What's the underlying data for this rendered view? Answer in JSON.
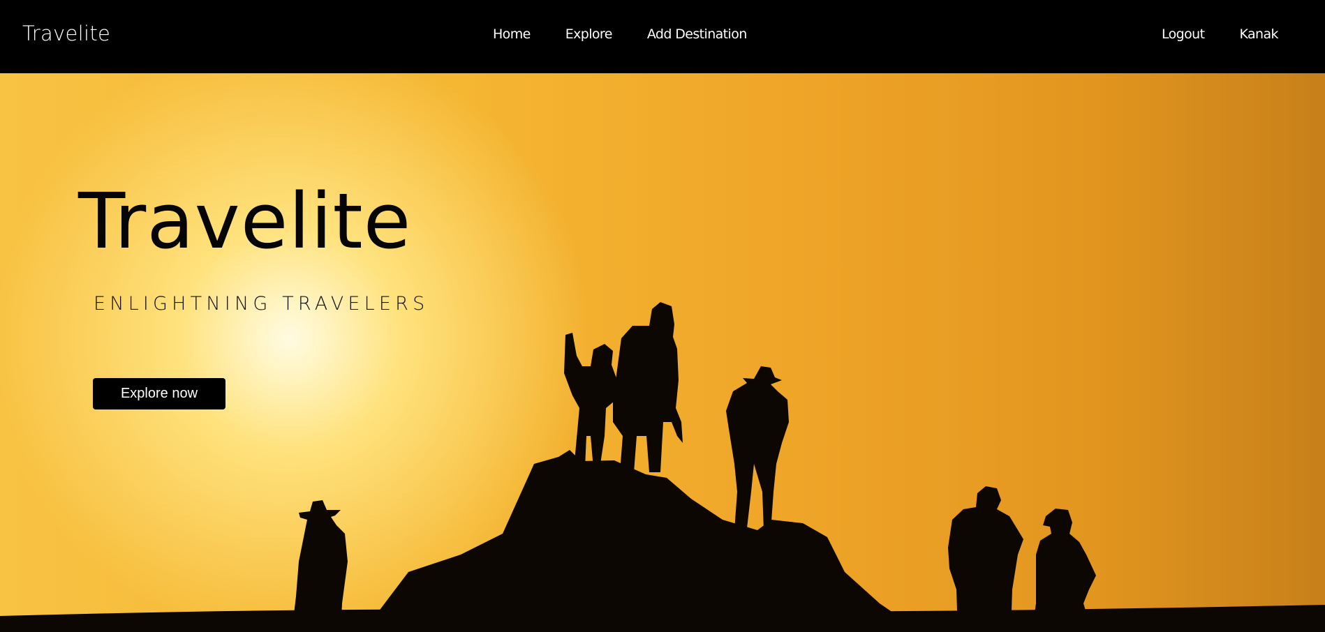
{
  "navbar": {
    "brand": "Travelite",
    "links": [
      {
        "label": "Home"
      },
      {
        "label": "Explore"
      },
      {
        "label": "Add Destination"
      }
    ],
    "user_links": [
      {
        "label": "Logout"
      },
      {
        "label": "Kanak"
      }
    ]
  },
  "hero": {
    "title": "Travelite",
    "subtitle": "ENLIGHTNING TRAVELERS",
    "cta_label": "Explore now",
    "background_image": "sunset-silhouette-hikers-on-rock",
    "colors": {
      "sky_light": "#fff3bd",
      "sky_mid": "#f5b632",
      "sky_dark": "#c7801a",
      "silhouette": "#0d0703"
    }
  }
}
